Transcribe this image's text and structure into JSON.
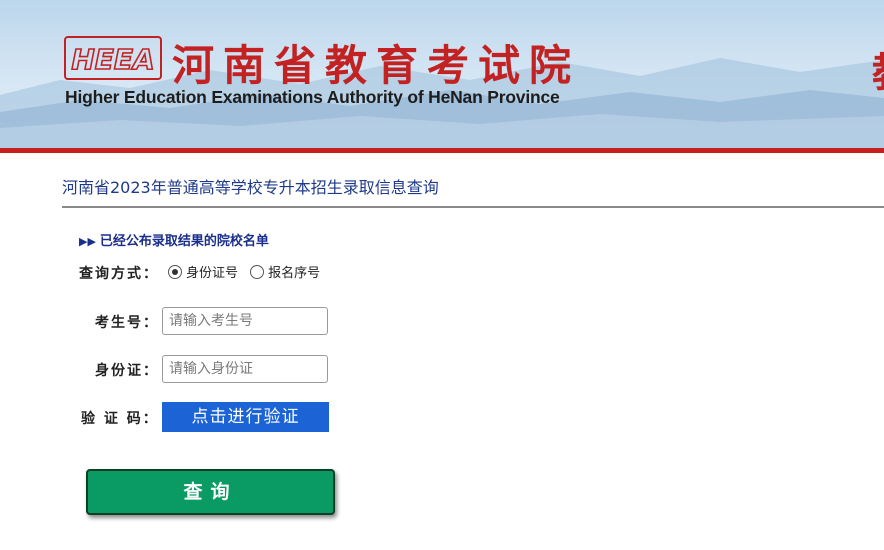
{
  "header": {
    "logo_text": "HEEA",
    "title_cn": "河南省教育考试院",
    "title_en": "Higher Education Examinations Authority of HeNan Province",
    "cut_text": "教",
    "brand_color": "#c32222"
  },
  "page": {
    "title": "河南省2023年普通高等学校专升本招生录取信息查询",
    "schools_link_arrows": "▶▶",
    "schools_link_label": "已经公布录取结果的院校名单"
  },
  "form": {
    "query_method_label": "查询方式：",
    "radio_options": [
      {
        "label": "身份证号",
        "checked": true
      },
      {
        "label": "报名序号",
        "checked": false
      }
    ],
    "exam_no_label": "考生号：",
    "exam_no_placeholder": "请输入考生号",
    "exam_no_value": "",
    "id_label": "身份证：",
    "id_placeholder": "请输入身份证",
    "id_value": "",
    "captcha_label": "验 证 码：",
    "verify_button_label": "点击进行验证",
    "query_button_label": "查询"
  },
  "colors": {
    "accent_red": "#c81e1e",
    "verify_blue": "#1c64d6",
    "query_green": "#0a9a63",
    "link_blue": "#1a2f8c"
  }
}
